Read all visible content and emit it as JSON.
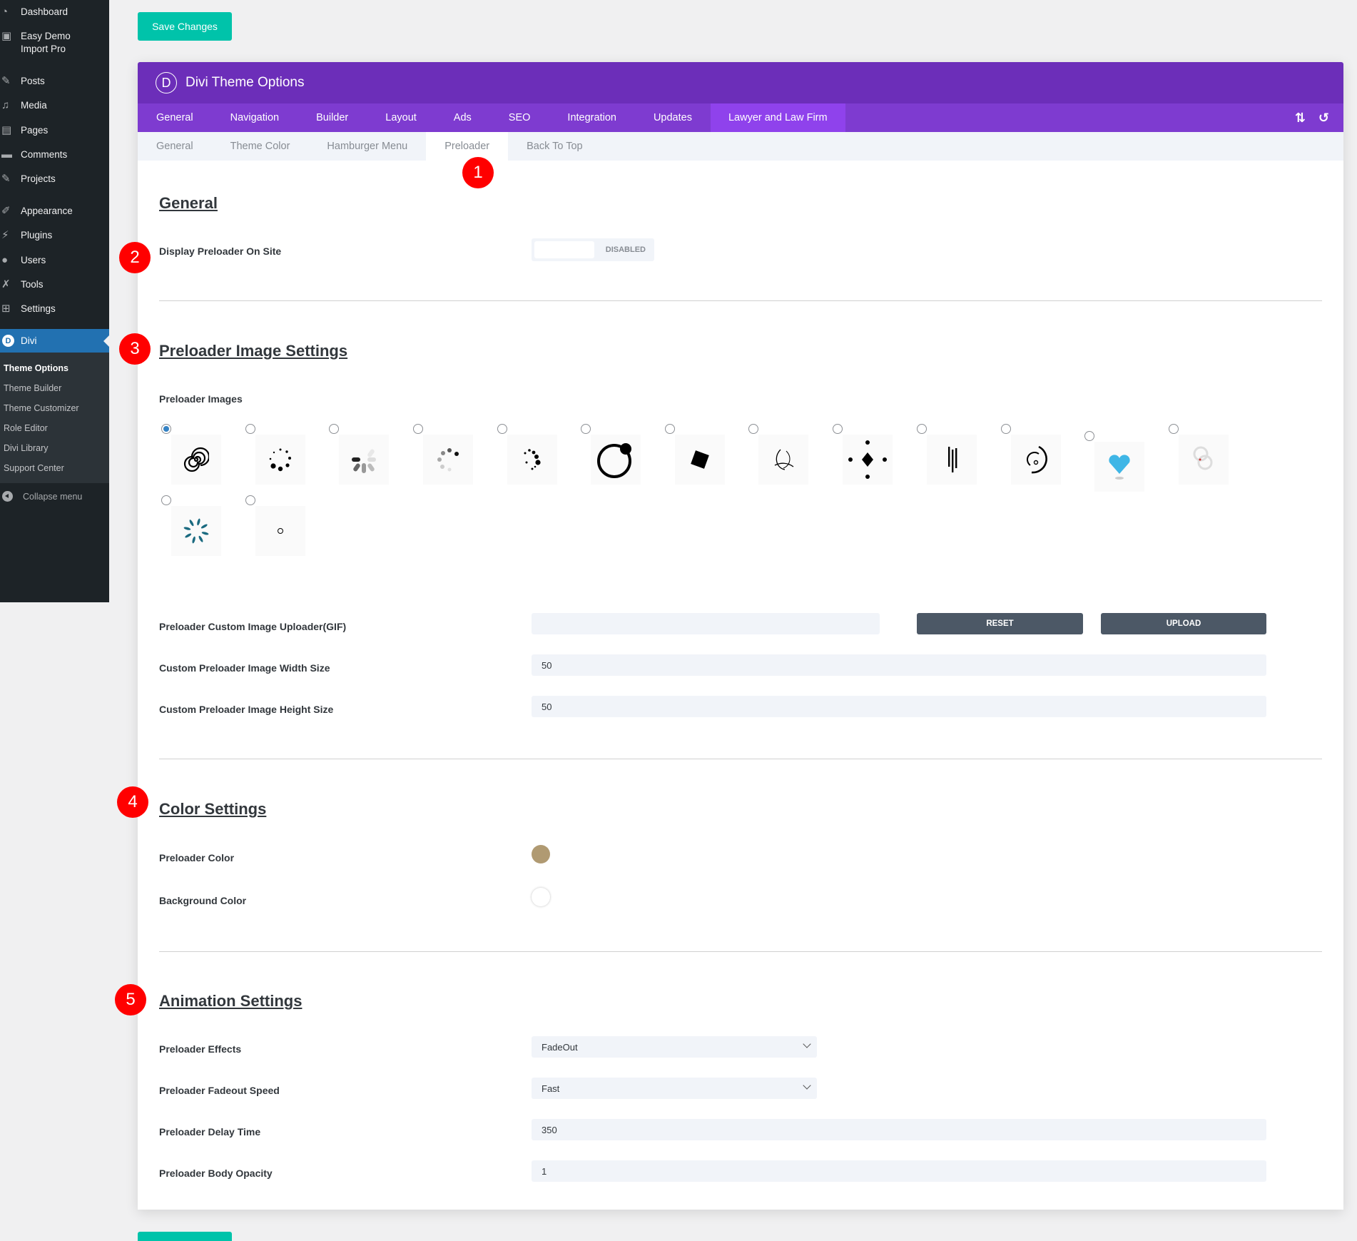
{
  "sidebar": {
    "items": [
      {
        "label": "Dashboard",
        "icon": "dashboard-icon",
        "glyph": "◔"
      },
      {
        "label": "Easy Demo Import Pro",
        "icon": "demo-import-icon",
        "glyph": "▣"
      },
      {
        "label": "Posts",
        "icon": "pin-icon",
        "glyph": "✎"
      },
      {
        "label": "Media",
        "icon": "media-icon",
        "glyph": "♫"
      },
      {
        "label": "Pages",
        "icon": "pages-icon",
        "glyph": "▤"
      },
      {
        "label": "Comments",
        "icon": "comment-icon",
        "glyph": "▬"
      },
      {
        "label": "Projects",
        "icon": "pin-icon",
        "glyph": "✎"
      },
      {
        "label": "Appearance",
        "icon": "brush-icon",
        "glyph": "✐"
      },
      {
        "label": "Plugins",
        "icon": "plugin-icon",
        "glyph": "⚡"
      },
      {
        "label": "Users",
        "icon": "user-icon",
        "glyph": "●"
      },
      {
        "label": "Tools",
        "icon": "wrench-icon",
        "glyph": "✗"
      },
      {
        "label": "Settings",
        "icon": "settings-icon",
        "glyph": "⊞"
      }
    ],
    "divi": {
      "label": "Divi",
      "logo": "D"
    },
    "submenu": [
      "Theme Options",
      "Theme Builder",
      "Theme Customizer",
      "Role Editor",
      "Divi Library",
      "Support Center"
    ],
    "collapse": "Collapse menu"
  },
  "toolbar": {
    "save_label": "Save Changes"
  },
  "panel": {
    "logo": "D",
    "title": "Divi Theme Options",
    "tabs": [
      "General",
      "Navigation",
      "Builder",
      "Layout",
      "Ads",
      "SEO",
      "Integration",
      "Updates",
      "Lawyer and Law Firm"
    ],
    "active_tab": "Lawyer and Law Firm",
    "icons": {
      "sort": "⇅",
      "reset": "↺"
    },
    "subtabs": [
      "General",
      "Theme Color",
      "Hamburger Menu",
      "Preloader",
      "Back To Top"
    ],
    "active_subtab": "Preloader"
  },
  "badges": [
    "1",
    "2",
    "3",
    "4",
    "5"
  ],
  "sections": {
    "general": {
      "title": "General",
      "display_label": "Display Preloader On Site",
      "toggle_state": "DISABLED"
    },
    "image": {
      "title": "Preloader Image Settings",
      "images_label": "Preloader Images",
      "selected_index": 0,
      "images": [
        "spiral",
        "dots-ring",
        "bars-spinner",
        "gray-dots",
        "black-dots",
        "ring-ball",
        "square",
        "arcs",
        "diamond",
        "lines",
        "circle-arc",
        "heart",
        "rings",
        "teal-petals",
        "small-circle"
      ],
      "uploader_label": "Preloader Custom Image Uploader(GIF)",
      "uploader_value": "",
      "reset_label": "RESET",
      "upload_label": "UPLOAD",
      "width_label": "Custom Preloader Image Width Size",
      "width_value": "50",
      "height_label": "Custom Preloader Image Height Size",
      "height_value": "50"
    },
    "color": {
      "title": "Color Settings",
      "preloader_color_label": "Preloader Color",
      "preloader_color": "#b09a72",
      "background_color_label": "Background Color",
      "background_color": "#ffffff"
    },
    "animation": {
      "title": "Animation Settings",
      "effects_label": "Preloader Effects",
      "effects_value": "FadeOut",
      "speed_label": "Preloader Fadeout Speed",
      "speed_value": "Fast",
      "delay_label": "Preloader Delay Time",
      "delay_value": "350",
      "opacity_label": "Preloader Body Opacity",
      "opacity_value": "1"
    }
  }
}
